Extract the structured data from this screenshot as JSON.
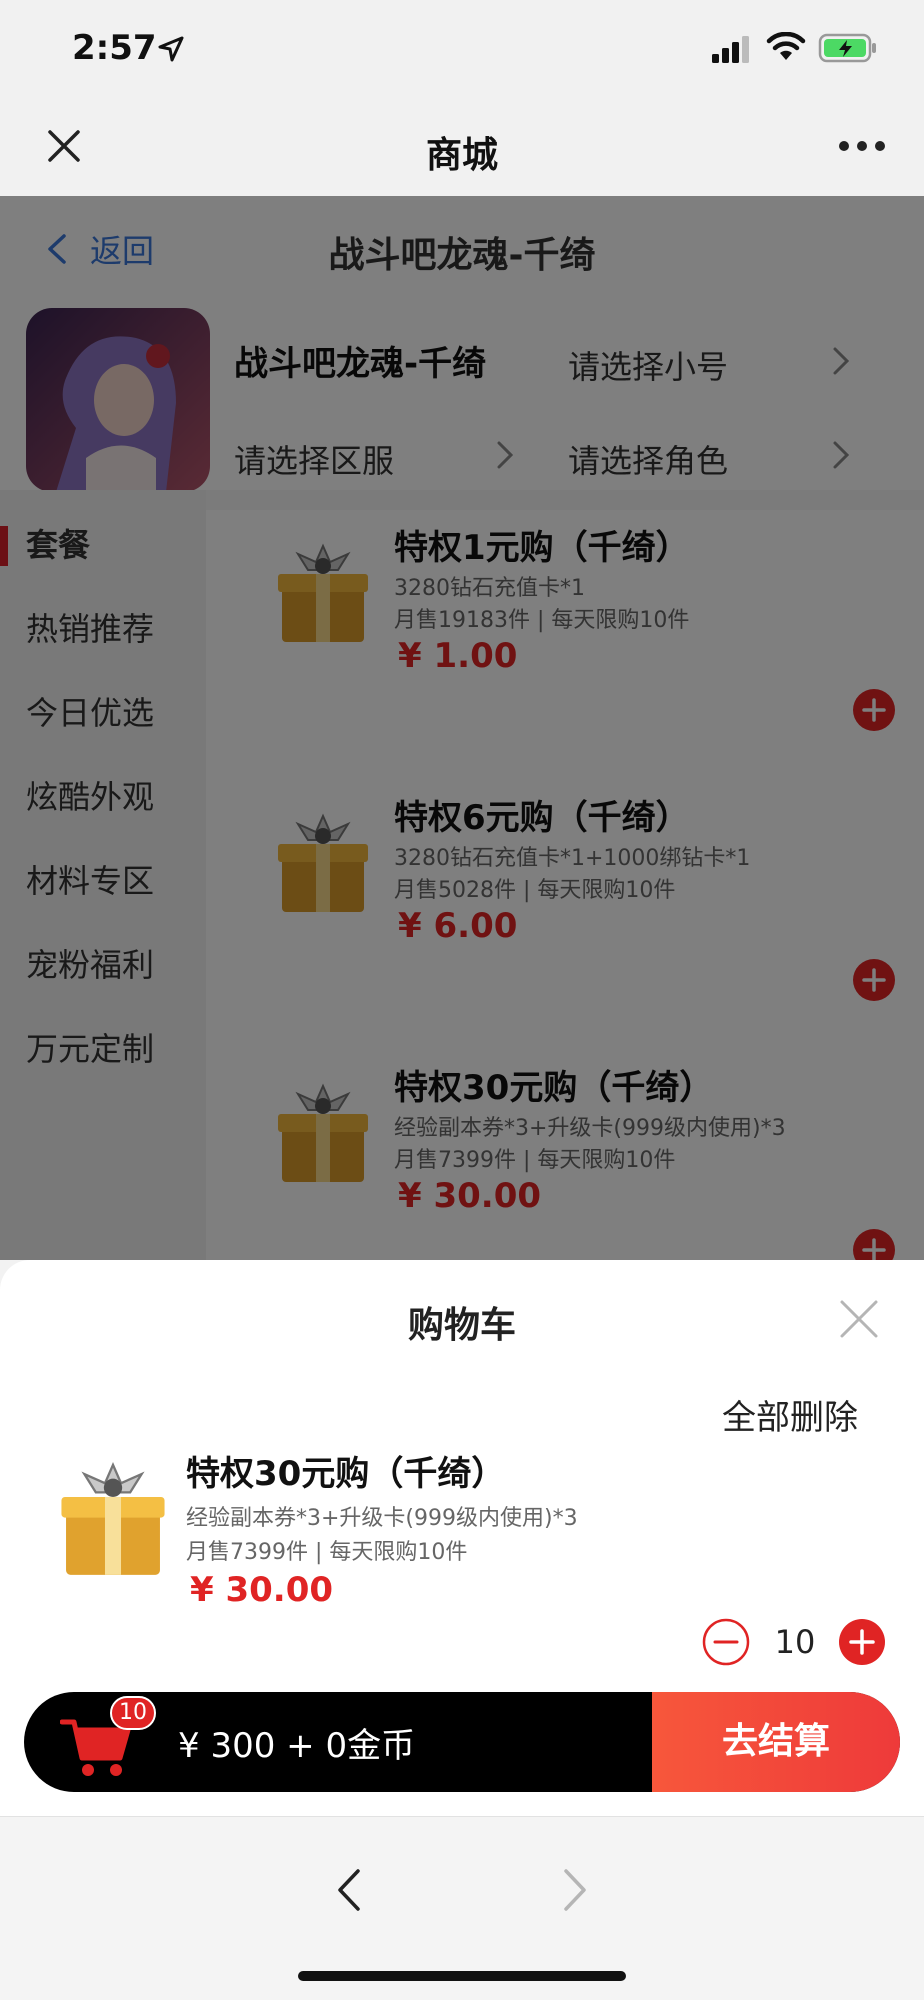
{
  "status_bar": {
    "time": "2:57"
  },
  "navbar": {
    "title": "商城"
  },
  "page": {
    "back_label": "返回",
    "title": "战斗吧龙魂-千绮",
    "game_name": "战斗吧龙魂-千绮",
    "select_account": "请选择小号",
    "select_server": "请选择区服",
    "select_role": "请选择角色"
  },
  "sidebar": {
    "items": [
      {
        "label": "套餐",
        "active": true
      },
      {
        "label": "热销推荐"
      },
      {
        "label": "今日优选"
      },
      {
        "label": "炫酷外观"
      },
      {
        "label": "材料专区"
      },
      {
        "label": "宠粉福利"
      },
      {
        "label": "万元定制"
      }
    ]
  },
  "products": [
    {
      "name": "特权1元购（千绮）",
      "desc": "3280钻石充值卡*1",
      "sales": "月售19183件 | 每天限购10件",
      "price": "¥ 1.00"
    },
    {
      "name": "特权6元购（千绮）",
      "desc": "3280钻石充值卡*1+1000绑钻卡*1",
      "sales": "月售5028件 | 每天限购10件",
      "price": "¥ 6.00"
    },
    {
      "name": "特权30元购（千绮）",
      "desc": "经验副本券*3+升级卡(999级内使用)*3",
      "sales": "月售7399件 | 每天限购10件",
      "price": "¥ 30.00"
    }
  ],
  "cart": {
    "title": "购物车",
    "delete_all": "全部删除",
    "item": {
      "name": "特权30元购（千绮）",
      "desc": "经验副本券*3+升级卡(999级内使用)*3",
      "sales": "月售7399件 | 每天限购10件",
      "price": "¥ 30.00",
      "quantity": "10"
    },
    "badge_count": "10",
    "total": "¥ 300 + 0金币",
    "checkout_label": "去结算"
  },
  "colors": {
    "accent_red": "#e02424",
    "link_blue": "#3a76d8",
    "checkout_orange": "#f7573b"
  },
  "icons": [
    "close-icon",
    "more-icon",
    "back-chevron-icon",
    "chevron-right-icon",
    "add-icon",
    "minus-icon",
    "cart-icon",
    "gift-box-icon",
    "signal-icon",
    "wifi-icon",
    "battery-icon"
  ]
}
